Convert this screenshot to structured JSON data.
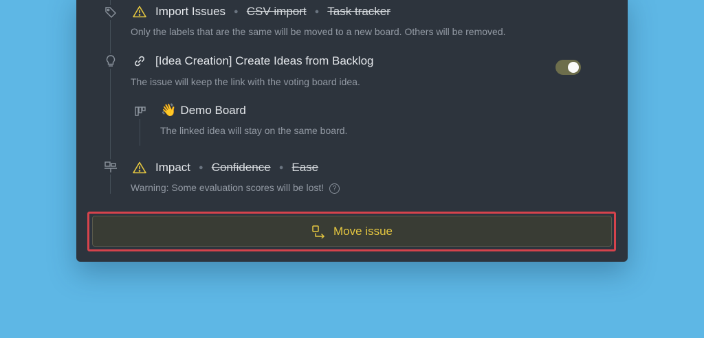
{
  "colors": {
    "background": "#5eb7e5",
    "panel": "#2d343d",
    "warning": "#e5c740",
    "highlight": "#d6434c",
    "toggle_on": "#6d6e4c"
  },
  "rows": [
    {
      "icon": "tag-icon",
      "lead_icon": "warning-triangle-icon",
      "title": "Import Issues",
      "struck": [
        "CSV import",
        "Task tracker"
      ],
      "description": "Only the labels that are the same will be moved to a new board. Others will be removed."
    },
    {
      "icon": "lightbulb-icon",
      "lead_icon": "link-icon",
      "title": "[Idea Creation] Create Ideas from Backlog",
      "description": "The issue will keep the link with the voting board idea.",
      "toggle_on": true,
      "sub": {
        "icon": "board-icon",
        "emoji": "👋",
        "title": "Demo Board",
        "description": "The linked idea will stay on the same board."
      }
    },
    {
      "icon": "scale-icon",
      "lead_icon": "warning-triangle-icon",
      "title": "Impact",
      "struck": [
        "Confidence",
        "Ease"
      ],
      "description": "Warning: Some evaluation scores will be lost!",
      "help_icon": "question-circle-icon"
    }
  ],
  "button": {
    "label": "Move issue",
    "icon": "move-icon"
  },
  "help_glyph": "?"
}
